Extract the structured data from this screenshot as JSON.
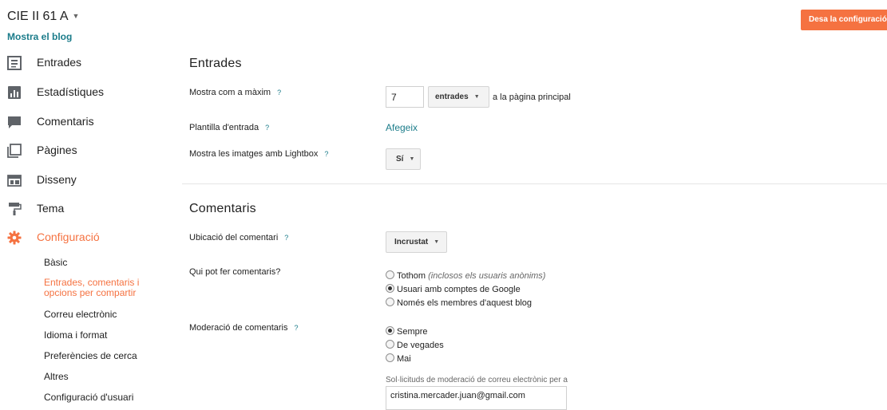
{
  "header": {
    "blog_title": "CIE II 61 A",
    "view_blog": "Mostra el blog",
    "save_button": "Desa la configuració"
  },
  "sidebar": {
    "items": [
      {
        "label": "Entrades",
        "icon": "posts-icon"
      },
      {
        "label": "Estadístiques",
        "icon": "stats-icon"
      },
      {
        "label": "Comentaris",
        "icon": "comments-icon"
      },
      {
        "label": "Pàgines",
        "icon": "pages-icon"
      },
      {
        "label": "Disseny",
        "icon": "layout-icon"
      },
      {
        "label": "Tema",
        "icon": "paint-roller-icon"
      },
      {
        "label": "Configuració",
        "icon": "gear-icon"
      }
    ],
    "subitems": [
      "Bàsic",
      "Entrades, comentaris i opcions per compartir",
      "Correu electrònic",
      "Idioma i format",
      "Preferències de cerca",
      "Altres",
      "Configuració d'usuari"
    ],
    "active_color": "#f57241"
  },
  "posts": {
    "title": "Entrades",
    "max_label": "Mostra com a màxim",
    "max_value": "7",
    "unit": "entrades",
    "unit_suffix": "a la pàgina principal",
    "template_label": "Plantilla d'entrada",
    "template_link": "Afegeix",
    "lightbox_label": "Mostra les imatges amb Lightbox",
    "lightbox_value": "Sí"
  },
  "comments": {
    "title": "Comentaris",
    "location_label": "Ubicació del comentari",
    "location_value": "Incrustat",
    "who_label": "Qui pot fer comentaris?",
    "who_options": {
      "everyone": "Tothom",
      "everyone_note": "(inclosos els usuaris anònims)",
      "google": "Usuari amb comptes de Google",
      "members": "Només els membres d'aquest blog"
    },
    "moderation_label": "Moderació de comentaris",
    "moderation_options": [
      "Sempre",
      "De vegades",
      "Mai"
    ],
    "email_label": "Sol·licituds de moderació de correu electrònic per a",
    "email_value": "cristina.mercader.juan@gmail.com"
  },
  "help_glyph": "?",
  "caret_glyph": "▼",
  "colors": {
    "accent": "#f57241",
    "link": "#1b7c8a"
  }
}
